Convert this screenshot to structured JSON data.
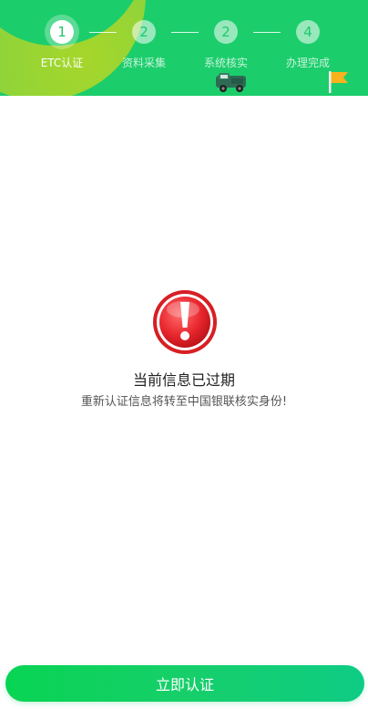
{
  "steps": [
    {
      "number": "1",
      "label": "ETC认证"
    },
    {
      "number": "2",
      "label": "资料采集"
    },
    {
      "number": "2",
      "label": "系统核实"
    },
    {
      "number": "4",
      "label": "办理完成"
    }
  ],
  "message": {
    "title": "当前信息已过期",
    "subtitle": "重新认证信息将转至中国银联核实身份!"
  },
  "action": {
    "button_label": "立即认证"
  },
  "colors": {
    "header": "#1ccd6c",
    "button": "#0fd065",
    "warning": "#e8262d",
    "flag": "#f7b21c"
  },
  "icons": {
    "warning": "warning-exclamation-icon",
    "car": "truck-icon",
    "flag": "flag-icon"
  }
}
